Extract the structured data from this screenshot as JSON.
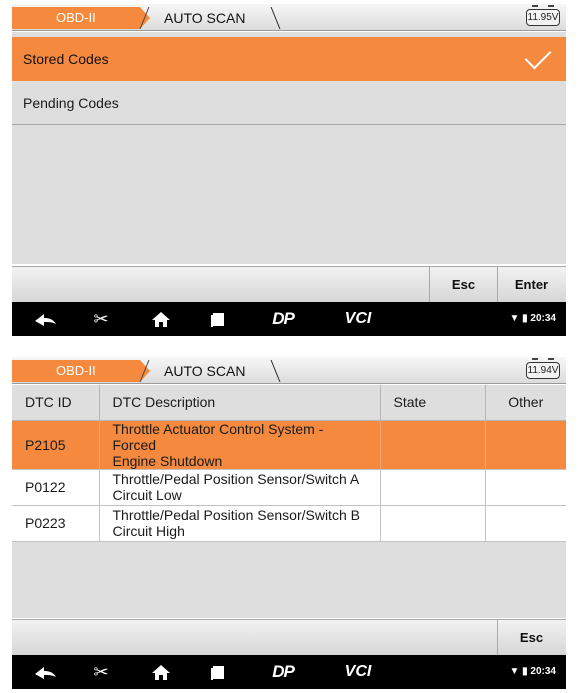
{
  "screen1": {
    "tabs": {
      "obd": "OBD-II",
      "scan": "AUTO SCAN"
    },
    "battery": "11.95V",
    "items": [
      {
        "label": "Stored Codes",
        "selected": true
      },
      {
        "label": "Pending Codes",
        "selected": false
      }
    ],
    "buttons": {
      "esc": "Esc",
      "enter": "Enter"
    },
    "time": "20:34"
  },
  "screen2": {
    "tabs": {
      "obd": "OBD-II",
      "scan": "AUTO SCAN"
    },
    "battery": "11.94V",
    "columns": [
      "DTC ID",
      "DTC Description",
      "State",
      "Other"
    ],
    "rows": [
      {
        "id": "P2105",
        "desc1": "Throttle Actuator Control System - Forced",
        "desc2": "Engine Shutdown",
        "state": "",
        "other": "",
        "selected": true
      },
      {
        "id": "P0122",
        "desc1": "Throttle/Pedal Position Sensor/Switch A",
        "desc2": "Circuit Low",
        "state": "",
        "other": "",
        "selected": false
      },
      {
        "id": "P0223",
        "desc1": "Throttle/Pedal Position Sensor/Switch B",
        "desc2": "Circuit High",
        "state": "",
        "other": "",
        "selected": false
      }
    ],
    "buttons": {
      "esc": "Esc"
    },
    "time": "20:34"
  },
  "nav": {
    "icons": [
      "back-icon",
      "scissors-icon",
      "home-icon",
      "recent-apps-icon",
      "dp-icon",
      "vci-icon"
    ],
    "dp_label": "DP",
    "vci_label": "VCI"
  },
  "colors": {
    "accent": "#f58a3f",
    "content_bg": "#dedede",
    "navbar": "#000000"
  }
}
